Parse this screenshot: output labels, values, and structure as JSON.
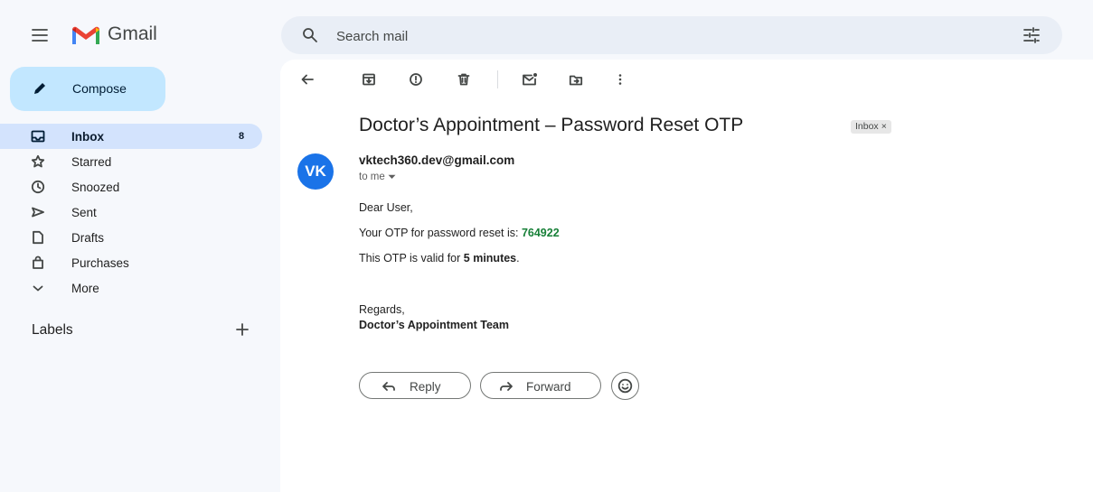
{
  "header": {
    "app_name": "Gmail",
    "search_placeholder": "Search mail"
  },
  "sidebar": {
    "compose_label": "Compose",
    "items": [
      {
        "label": "Inbox",
        "count": "8",
        "icon": "inbox-icon",
        "active": true
      },
      {
        "label": "Starred",
        "count": "",
        "icon": "star-icon",
        "active": false
      },
      {
        "label": "Snoozed",
        "count": "",
        "icon": "clock-icon",
        "active": false
      },
      {
        "label": "Sent",
        "count": "",
        "icon": "send-icon",
        "active": false
      },
      {
        "label": "Drafts",
        "count": "",
        "icon": "draft-icon",
        "active": false
      },
      {
        "label": "Purchases",
        "count": "",
        "icon": "shopping-bag-icon",
        "active": false
      },
      {
        "label": "More",
        "count": "",
        "icon": "chevron-down-icon",
        "active": false
      }
    ],
    "labels_heading": "Labels",
    "labels_add": "+"
  },
  "toolbar": {
    "icons": [
      "back-arrow-icon",
      "archive-icon",
      "report-spam-icon",
      "delete-icon",
      "mark-unread-icon",
      "move-to-icon",
      "more-vert-icon"
    ]
  },
  "email": {
    "subject": "Doctor’s Appointment – Password Reset OTP",
    "label_chip": "Inbox",
    "label_chip_close": "×",
    "avatar_initials": "VK",
    "avatar_color": "#1a73e8",
    "sender": "vktech360.dev@gmail.com",
    "recipient": "to me",
    "greeting": "Dear User,",
    "otp_prefix": "Your OTP for password reset is: ",
    "otp_code": "764922",
    "otp_color": "#188038",
    "valid_prefix": "This OTP is valid for ",
    "valid_strong": "5 minutes",
    "valid_suffix": ".",
    "sign_off": "Regards,",
    "sign_team": "Doctor’s Appointment Team"
  },
  "actions": {
    "reply_label": "Reply",
    "forward_label": "Forward"
  },
  "colors": {
    "page_bg": "#f6f8fc",
    "compose_bg": "#c2e7ff",
    "active_nav_bg": "#d3e3fd",
    "search_bg": "#e9eef6"
  }
}
